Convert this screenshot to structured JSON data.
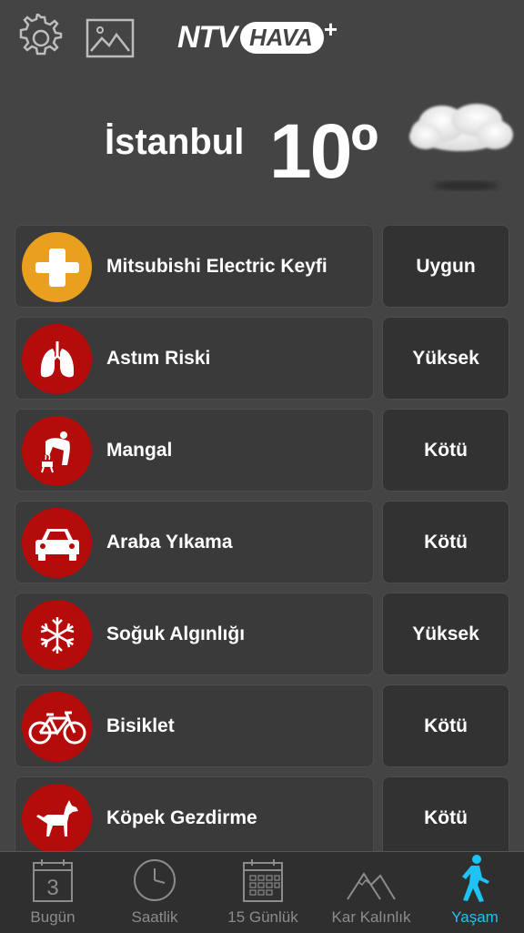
{
  "brand": {
    "ntv": "NTV",
    "hava": "HAVA",
    "plus": "+"
  },
  "header": {
    "city": "İstanbul",
    "temperature": "10º",
    "condition_icon": "cloud-icon"
  },
  "rows": [
    {
      "label": "Mitsubishi Electric Keyfi",
      "status": "Uygun",
      "icon": "plus-icon",
      "color": "#E8A01E"
    },
    {
      "label": "Astım Riski",
      "status": "Yüksek",
      "icon": "lungs-icon",
      "color": "#B40B0B"
    },
    {
      "label": "Mangal",
      "status": "Kötü",
      "icon": "barbecue-icon",
      "color": "#B40B0B"
    },
    {
      "label": "Araba Yıkama",
      "status": "Kötü",
      "icon": "car-icon",
      "color": "#B40B0B"
    },
    {
      "label": "Soğuk Algınlığı",
      "status": "Yüksek",
      "icon": "snowflake-icon",
      "color": "#B40B0B"
    },
    {
      "label": "Bisiklet",
      "status": "Kötü",
      "icon": "bicycle-icon",
      "color": "#B40B0B"
    },
    {
      "label": "Köpek Gezdirme",
      "status": "Kötü",
      "icon": "dog-icon",
      "color": "#B40B0B"
    }
  ],
  "tabs": [
    {
      "label": "Bugün",
      "icon": "calendar-day-icon",
      "day": "3",
      "active": false
    },
    {
      "label": "Saatlik",
      "icon": "clock-icon",
      "active": false
    },
    {
      "label": "15 Günlük",
      "icon": "calendar-grid-icon",
      "active": false
    },
    {
      "label": "Kar Kalınlık",
      "icon": "mountain-icon",
      "active": false
    },
    {
      "label": "Yaşam",
      "icon": "hiker-icon",
      "active": true
    }
  ],
  "colors": {
    "active_tab": "#1EC3F5",
    "inactive_tab": "#8C8C8C",
    "background": "#444444"
  }
}
